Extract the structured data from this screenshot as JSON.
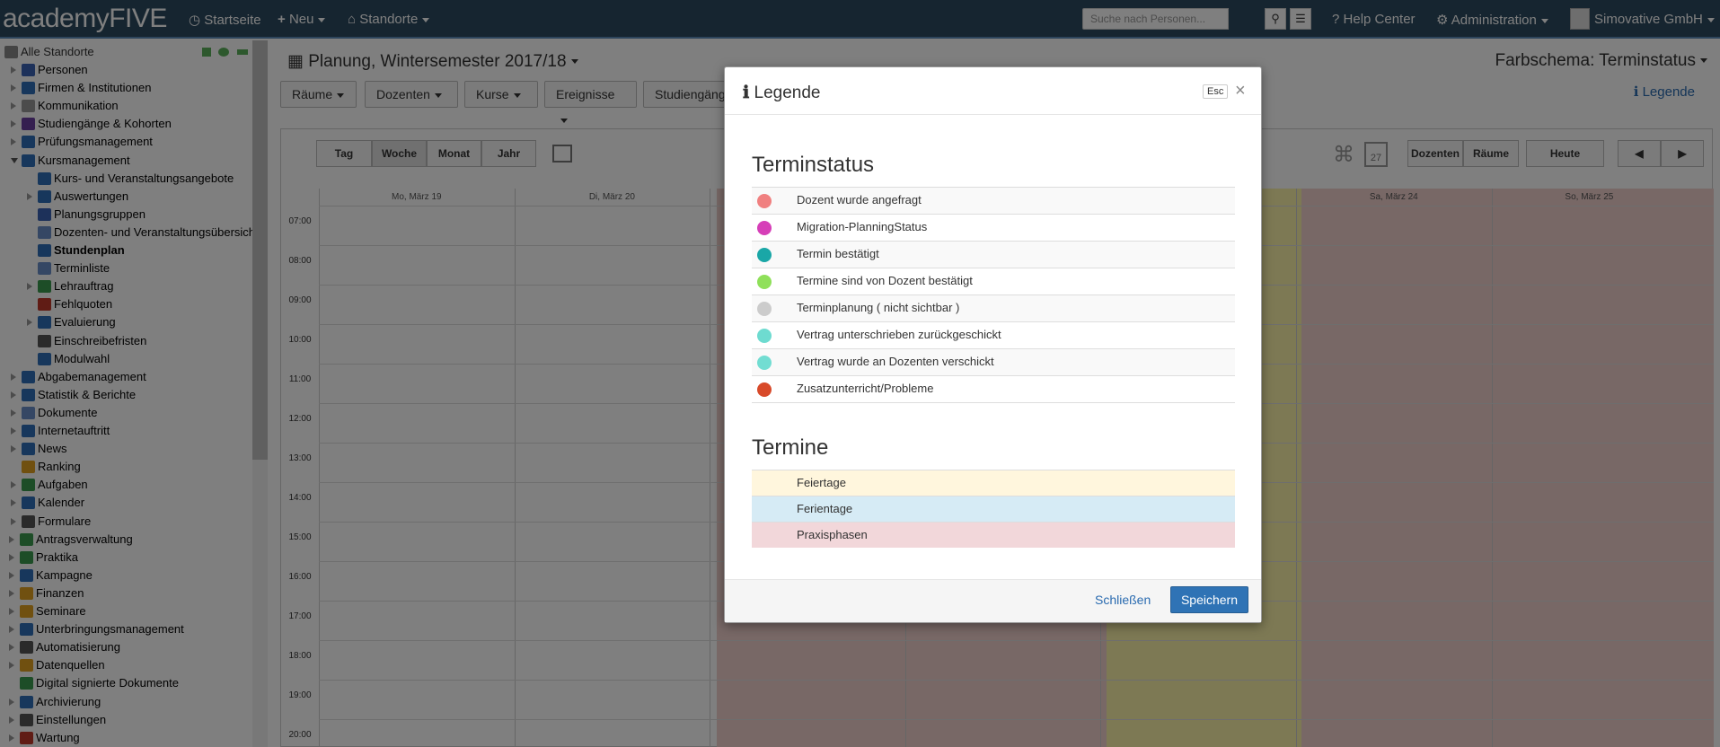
{
  "topbar": {
    "logo": "academyFIVE",
    "nav": {
      "start": "Startseite",
      "neu": "Neu",
      "standorte": "Standorte"
    },
    "search_placeholder": "Suche nach Personen...",
    "help": "Help Center",
    "admin": "Administration",
    "user": "Simovative GmbH"
  },
  "sidebar": {
    "root": "Alle Standorte",
    "items": [
      {
        "label": "Personen",
        "icon": "persons-icon",
        "color": "#3a62b5"
      },
      {
        "label": "Firmen & Institutionen",
        "icon": "building-icon",
        "color": "#2f6fb8"
      },
      {
        "label": "Kommunikation",
        "icon": "envelope-icon",
        "color": "#999999"
      },
      {
        "label": "Studiengänge & Kohorten",
        "icon": "feather-icon",
        "color": "#6a3fa0"
      },
      {
        "label": "Prüfungsmanagement",
        "icon": "clipboard-icon",
        "color": "#2f6fb8"
      },
      {
        "label": "Kursmanagement",
        "icon": "book-icon",
        "color": "#2f6fb8"
      },
      {
        "label": "Kurs- und Veranstaltungsangebote",
        "icon": "book-icon",
        "color": "#2f6fb8"
      },
      {
        "label": "Auswertungen",
        "icon": "bar-chart-icon",
        "color": "#2f6fb8"
      },
      {
        "label": "Planungsgruppen",
        "icon": "group-icon",
        "color": "#3a62b5"
      },
      {
        "label": "Dozenten- und Veranstaltungsübersich",
        "icon": "folder-icon",
        "color": "#6a8fc9"
      },
      {
        "label": "Stundenplan",
        "icon": "calendar-icon",
        "color": "#2f6fb8"
      },
      {
        "label": "Terminliste",
        "icon": "calendar-list-icon",
        "color": "#6a8fc9"
      },
      {
        "label": "Lehrauftrag",
        "icon": "contract-icon",
        "color": "#3a9b4f"
      },
      {
        "label": "Fehlquoten",
        "icon": "percent-icon",
        "color": "#c0392b"
      },
      {
        "label": "Evaluierung",
        "icon": "line-chart-icon",
        "color": "#2f6fb8"
      },
      {
        "label": "Einschreibefristen",
        "icon": "clock-icon",
        "color": "#555555"
      },
      {
        "label": "Modulwahl",
        "icon": "modules-icon",
        "color": "#2f6fb8"
      },
      {
        "label": "Abgabemanagement",
        "icon": "submission-icon",
        "color": "#2f6fb8"
      },
      {
        "label": "Statistik & Berichte",
        "icon": "stats-icon",
        "color": "#2f6fb8"
      },
      {
        "label": "Dokumente",
        "icon": "folder-icon",
        "color": "#6a8fc9"
      },
      {
        "label": "Internetauftritt",
        "icon": "globe-icon",
        "color": "#2f6fb8"
      },
      {
        "label": "News",
        "icon": "info-icon",
        "color": "#2f6fb8"
      },
      {
        "label": "Ranking",
        "icon": "award-icon",
        "color": "#e0a020"
      },
      {
        "label": "Aufgaben",
        "icon": "history-icon",
        "color": "#3a9b4f"
      },
      {
        "label": "Kalender",
        "icon": "calendar-icon",
        "color": "#2f6fb8"
      },
      {
        "label": "Formulare",
        "icon": "form-icon",
        "color": "#555555"
      },
      {
        "label": "Antragsverwaltung",
        "icon": "request-icon",
        "color": "#3a9b4f"
      },
      {
        "label": "Praktika",
        "icon": "internship-icon",
        "color": "#3a9b4f"
      },
      {
        "label": "Kampagne",
        "icon": "campaign-icon",
        "color": "#2f6fb8"
      },
      {
        "label": "Finanzen",
        "icon": "coins-icon",
        "color": "#e0a020"
      },
      {
        "label": "Seminare",
        "icon": "briefcase-icon",
        "color": "#e0a020"
      },
      {
        "label": "Unterbringungsmanagement",
        "icon": "hotel-icon",
        "color": "#2f6fb8"
      },
      {
        "label": "Automatisierung",
        "icon": "gear-icon",
        "color": "#555555"
      },
      {
        "label": "Datenquellen",
        "icon": "datasource-icon",
        "color": "#e0a020"
      },
      {
        "label": "Digital signierte Dokumente",
        "icon": "signed-doc-icon",
        "color": "#3a9b4f"
      },
      {
        "label": "Archivierung",
        "icon": "archive-icon",
        "color": "#2f6fb8"
      },
      {
        "label": "Einstellungen",
        "icon": "settings-icon",
        "color": "#555555"
      },
      {
        "label": "Wartung",
        "icon": "maintenance-icon",
        "color": "#c0392b"
      }
    ]
  },
  "main": {
    "title": "Planung, Wintersemester 2017/18",
    "farbschema": "Farbschema: Terminstatus",
    "legende_link": "Legende",
    "filters": [
      "Räume",
      "Dozenten",
      "Kurse",
      "Ereignisse",
      "Studiengänge"
    ],
    "views": [
      "Tag",
      "Woche",
      "Monat",
      "Jahr"
    ],
    "right_buttons": {
      "dozenten": "Dozenten",
      "raeume": "Räume",
      "heute": "Heute",
      "cal_day": "27"
    },
    "days": [
      "Mo, März 19",
      "Di, März 20",
      "",
      "",
      "",
      "Sa, März 24",
      "So, März 25"
    ],
    "hours": [
      "07:00",
      "08:00",
      "09:00",
      "10:00",
      "11:00",
      "12:00",
      "13:00",
      "14:00",
      "15:00",
      "16:00",
      "17:00",
      "18:00",
      "19:00",
      "20:00"
    ]
  },
  "modal": {
    "title": "Legende",
    "esc": "Esc",
    "section1": "Terminstatus",
    "status": [
      {
        "label": "Dozent wurde angefragt",
        "color": "#f08080"
      },
      {
        "label": "Migration-PlanningStatus",
        "color": "#d63fb8"
      },
      {
        "label": "Termin bestätigt",
        "color": "#1aa7a7"
      },
      {
        "label": "Termine sind von Dozent bestätigt",
        "color": "#8fe05a"
      },
      {
        "label": "Terminplanung ( nicht sichtbar )",
        "color": "#cccccc"
      },
      {
        "label": "Vertrag unterschrieben zurückgeschickt",
        "color": "#6edbd0"
      },
      {
        "label": "Vertrag wurde an Dozenten verschickt",
        "color": "#72ddd2"
      },
      {
        "label": "Zusatzunterricht/Probleme",
        "color": "#d84a2a"
      }
    ],
    "section2": "Termine",
    "termine": [
      {
        "label": "Feiertage",
        "color": "#fff6dd"
      },
      {
        "label": "Ferientage",
        "color": "#d6ebf5"
      },
      {
        "label": "Praxisphasen",
        "color": "#f2d7da"
      }
    ],
    "close_label": "Schließen",
    "save_label": "Speichern"
  }
}
